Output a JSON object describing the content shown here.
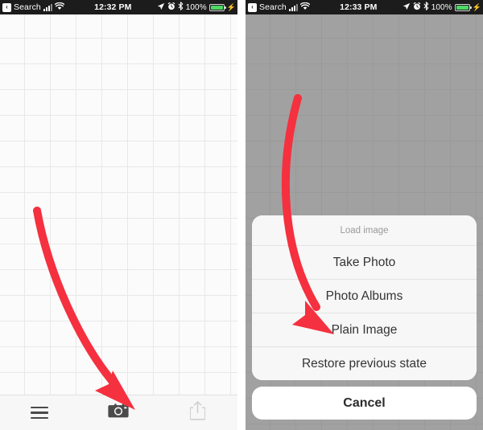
{
  "left_phone": {
    "status_bar": {
      "back_chip": "‹",
      "carrier_label": "Search",
      "signal_icon": "cellular-signal-icon",
      "wifi_icon": "wifi-icon",
      "time": "12:32 PM",
      "location_icon": "location-arrow-icon",
      "alarm_icon": "alarm-clock-icon",
      "bluetooth_icon": "bluetooth-icon",
      "battery_percent": "100%",
      "battery_icon": "battery-full-icon",
      "charging_icon": "lightning-bolt-icon"
    },
    "canvas": {
      "name": "grid-canvas",
      "grid_size_px": "32"
    },
    "toolbar": {
      "menu_label": "menu-icon",
      "camera_label": "camera-icon",
      "share_label": "share-icon",
      "share_disabled": "true"
    },
    "annotation": {
      "arrow_color": "#f5303f",
      "arrow_target": "camera-icon"
    }
  },
  "right_phone": {
    "status_bar": {
      "back_chip": "‹",
      "carrier_label": "Search",
      "signal_icon": "cellular-signal-icon",
      "wifi_icon": "wifi-icon",
      "time": "12:33 PM",
      "location_icon": "location-arrow-icon",
      "alarm_icon": "alarm-clock-icon",
      "bluetooth_icon": "bluetooth-icon",
      "battery_percent": "100%",
      "battery_icon": "battery-full-icon",
      "charging_icon": "lightning-bolt-icon"
    },
    "action_sheet": {
      "title": "Load image",
      "options": [
        {
          "label": "Take Photo"
        },
        {
          "label": "Photo Albums"
        },
        {
          "label": "Plain Image"
        },
        {
          "label": "Restore previous state"
        }
      ],
      "cancel_label": "Cancel"
    },
    "annotation": {
      "arrow_color": "#f5303f",
      "arrow_target": "Plain Image"
    }
  },
  "colors": {
    "accent_red": "#f5303f",
    "battery_green": "#4cd964",
    "status_bar_bg": "#1c1c1c",
    "canvas_bg": "#fbfbfb",
    "grid_line": "#e8e8e8",
    "sheet_bg": "#f7f7f7"
  }
}
